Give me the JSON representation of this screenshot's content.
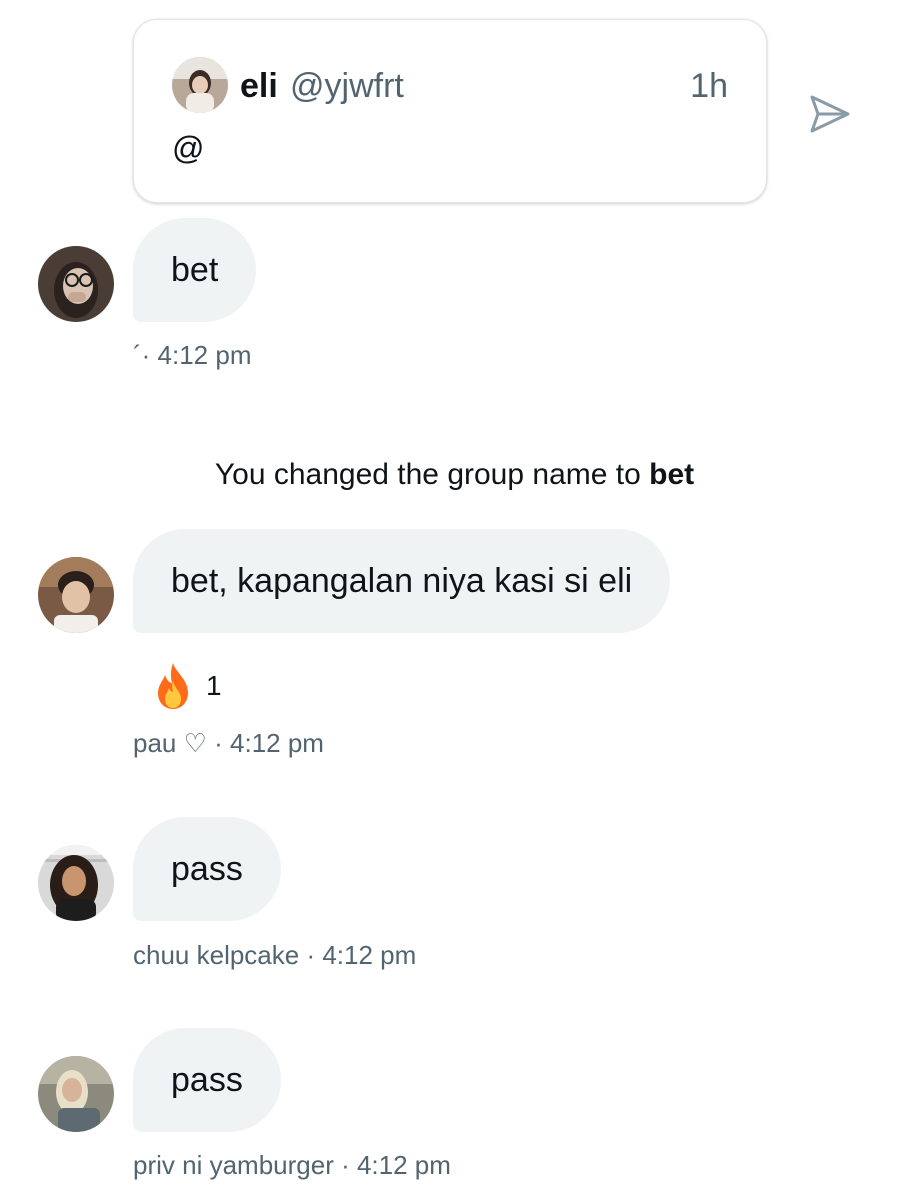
{
  "quoted_tweet": {
    "name": "eli",
    "handle": "@yjwfrt",
    "time": "1h",
    "text": "@"
  },
  "icons": {
    "share": "send-icon",
    "reaction": "fire-emoji"
  },
  "messages": [
    {
      "text": "bet",
      "sender": "",
      "time_meta": "´· 4:12 pm"
    },
    {
      "text": "bet, kapangalan niya kasi si eli",
      "sender": "pau ♡",
      "time_meta": "pau ♡ · 4:12 pm",
      "reaction_emoji": "🔥",
      "reaction_count": "1"
    },
    {
      "text": "pass",
      "sender": "chuu kelpcake",
      "time_meta": "chuu kelpcake · 4:12 pm"
    },
    {
      "text": "pass",
      "sender": "priv ni yamburger",
      "time_meta": "priv ni yamburger · 4:12 pm"
    }
  ],
  "system_message": {
    "prefix": "You changed the group name to ",
    "group_name": "bet"
  },
  "colors": {
    "bubble_bg": "#eff3f4",
    "secondary_text": "#536471",
    "primary_text": "#0f1419",
    "share_icon": "#8a9ba8"
  }
}
